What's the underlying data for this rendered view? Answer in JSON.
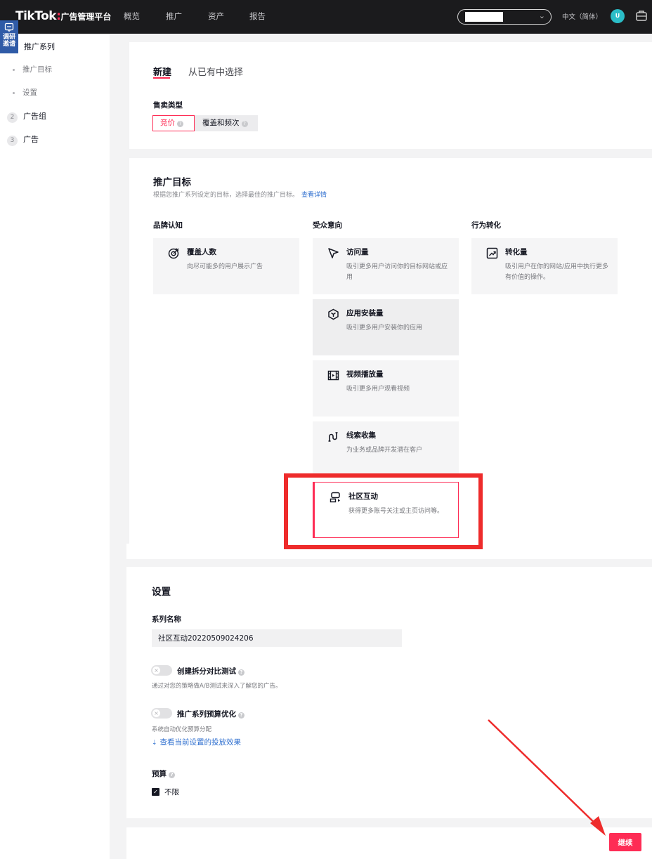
{
  "header": {
    "brand": "TikTok",
    "brand_sep": ":",
    "brand_sub": "广告管理平台",
    "nav": [
      "概览",
      "推广",
      "资产",
      "报告"
    ],
    "language": "中文（简体）",
    "avatar_letter": "U"
  },
  "survey": {
    "label": "调研邀请"
  },
  "sidebar": {
    "campaign": "推广系列",
    "sub_items": [
      "推广目标",
      "设置"
    ],
    "steps": [
      {
        "num": "2",
        "label": "广告组"
      },
      {
        "num": "3",
        "label": "广告"
      }
    ]
  },
  "create": {
    "tabs": [
      "新建",
      "从已有中选择"
    ],
    "sale_type_label": "售卖类型",
    "sale_types": [
      "竞价",
      "覆盖和频次"
    ]
  },
  "objective": {
    "title": "推广目标",
    "desc": "根据您推广系列设定的目标，选择最佳的推广目标。",
    "link": "查看详情",
    "columns": [
      "品牌认知",
      "受众意向",
      "行为转化"
    ],
    "tiles": {
      "reach": {
        "name": "覆盖人数",
        "desc": "向尽可能多的用户展示广告",
        "icon": "target-icon"
      },
      "traffic": {
        "name": "访问量",
        "desc": "吸引更多用户访问你的目标网站或应用",
        "icon": "cursor-icon"
      },
      "app_install": {
        "name": "应用安装量",
        "desc": "吸引更多用户安装你的应用",
        "icon": "cube-icon"
      },
      "video_views": {
        "name": "视频播放量",
        "desc": "吸引更多用户观看视频",
        "icon": "film-icon"
      },
      "lead_gen": {
        "name": "线索收集",
        "desc": "为业务或品牌开发潜在客户",
        "icon": "magnet-icon"
      },
      "community": {
        "name": "社区互动",
        "desc": "获得更多账号关注或主页访问等。",
        "icon": "community-icon"
      },
      "conversions": {
        "name": "转化量",
        "desc": "吸引用户在你的网站/应用中执行更多有价值的操作。",
        "icon": "chart-up-icon"
      }
    }
  },
  "settings": {
    "title": "设置",
    "name_label": "系列名称",
    "name_value": "社区互动20220509024206",
    "split_test_label": "创建拆分对比测试",
    "split_test_hint": "通过对您的策略做A/B测试来深入了解您的广告。",
    "budget_opt_label": "推广系列预算优化",
    "budget_opt_hint": "系统自动优化预算分配",
    "view_effect_link": "查看当前设置的投放效果",
    "budget_label": "预算",
    "unlimited_label": "不限"
  },
  "footer": {
    "continue_label": "继续"
  },
  "colors": {
    "accent": "#fe2c55",
    "annotation": "#ee2b2b",
    "link": "#2d6ecf"
  }
}
